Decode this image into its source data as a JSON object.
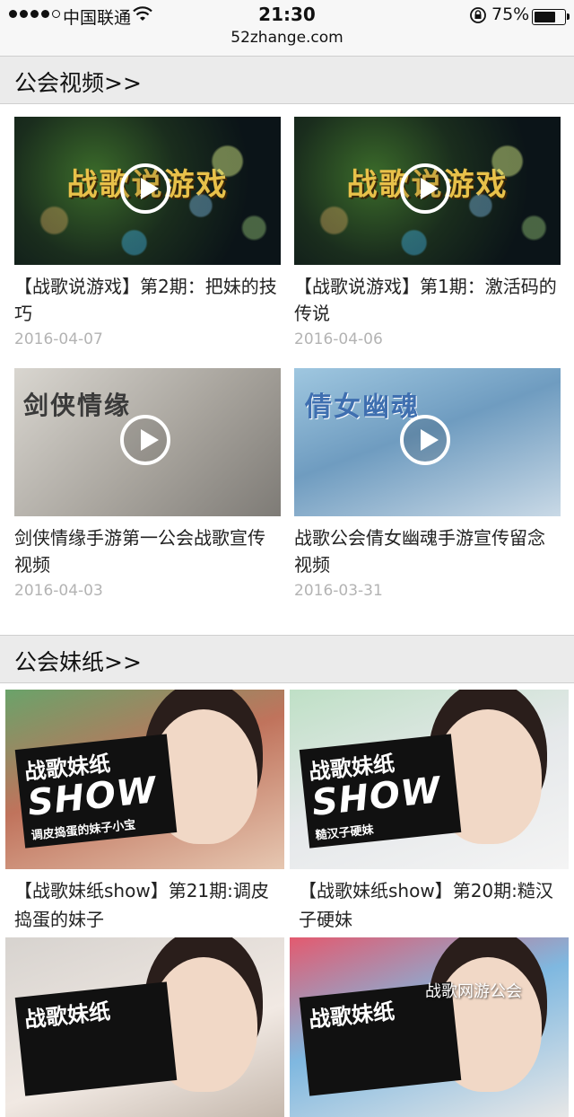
{
  "status_bar": {
    "carrier": "中国联通",
    "time": "21:30",
    "battery_percent": "75%",
    "battery_level": 0.75,
    "url": "52zhange.com"
  },
  "sections": {
    "videos": {
      "title": "公会视频>>",
      "items": [
        {
          "thumb_text": "战歌说游戏",
          "title": "【战歌说游戏】第2期：把妹的技巧",
          "date": "2016-04-07"
        },
        {
          "thumb_text": "战歌说游戏",
          "title": "【战歌说游戏】第1期：激活码的传说",
          "date": "2016-04-06"
        },
        {
          "thumb_text": "剑侠情缘",
          "title": "剑侠情缘手游第一公会战歌宣传视频",
          "date": "2016-04-03"
        },
        {
          "thumb_text": "倩女幽魂",
          "title": "战歌公会倩女幽魂手游宣传留念视频",
          "date": "2016-03-31"
        }
      ]
    },
    "meizi": {
      "title": "公会妹纸>>",
      "items": [
        {
          "badge_top": "战歌妹纸",
          "badge_show": "SHOW",
          "badge_issue": "调皮捣蛋的妹子小宝",
          "title": "【战歌妹纸show】第21期:调皮捣蛋的妹子"
        },
        {
          "badge_top": "战歌妹纸",
          "badge_show": "SHOW",
          "badge_issue": "糙汉子硬妹",
          "title": "【战歌妹纸show】第20期:糙汉子硬妹"
        },
        {
          "badge_top": "战歌妹纸",
          "badge_show": "",
          "badge_issue": "",
          "title": ""
        },
        {
          "badge_top": "战歌妹纸",
          "badge_show": "",
          "badge_issue": "",
          "title": ""
        }
      ]
    }
  },
  "watermark": "战歌网游公会"
}
